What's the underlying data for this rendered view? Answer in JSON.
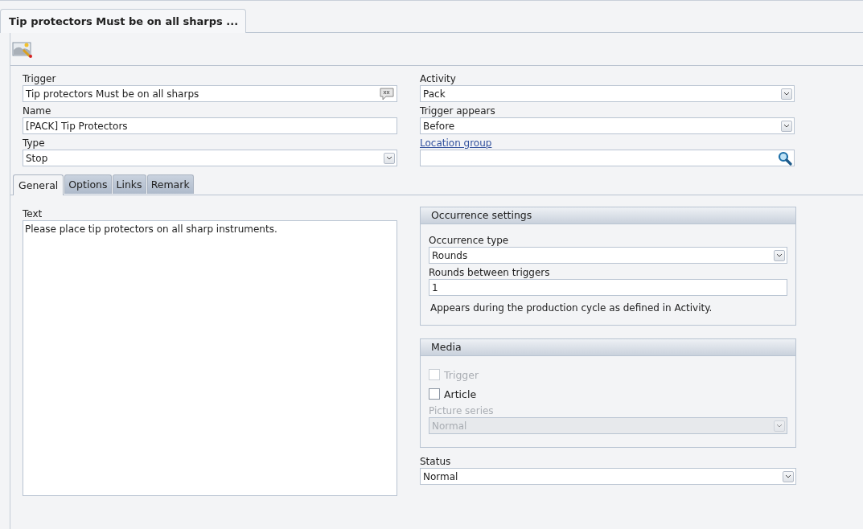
{
  "document_tab": {
    "title": "Tip protectors Must be on all sharps ..."
  },
  "header_fields": {
    "left": [
      {
        "label": "Trigger",
        "value": "Tip protectors Must be on all sharps",
        "kind": "translate"
      },
      {
        "label": "Name",
        "value": "[PACK] Tip Protectors",
        "kind": "text"
      },
      {
        "label": "Type",
        "value": "Stop",
        "kind": "select"
      }
    ],
    "right": [
      {
        "label": "Activity",
        "value": "Pack",
        "kind": "select"
      },
      {
        "label": "Trigger appears",
        "value": "Before",
        "kind": "select"
      },
      {
        "label": "Location group",
        "label_link": true,
        "kind": "lookup"
      }
    ]
  },
  "tabs": [
    {
      "label": "General",
      "selected": true
    },
    {
      "label": "Options",
      "selected": false
    },
    {
      "label": "Links",
      "selected": false
    },
    {
      "label": "Remark",
      "selected": false
    }
  ],
  "text_field": {
    "label": "Text",
    "value": "Please place tip protectors on all sharp instruments."
  },
  "occurrence_settings": {
    "title": "Occurrence settings",
    "fields": [
      {
        "label": "Occurrence type",
        "value": "Rounds",
        "kind": "select"
      },
      {
        "label": "Rounds between triggers",
        "value": "1",
        "kind": "text"
      }
    ],
    "note": "Appears during the production cycle as defined in Activity."
  },
  "media": {
    "title": "Media",
    "checkboxes": [
      {
        "label": "Trigger",
        "checked": false,
        "disabled": true
      },
      {
        "label": "Article",
        "checked": false,
        "disabled": false
      }
    ],
    "picture_series": {
      "label": "Picture series",
      "value": "Normal",
      "kind": "select",
      "disabled": true
    }
  },
  "status": {
    "label": "Status",
    "value": "Normal",
    "kind": "select"
  }
}
